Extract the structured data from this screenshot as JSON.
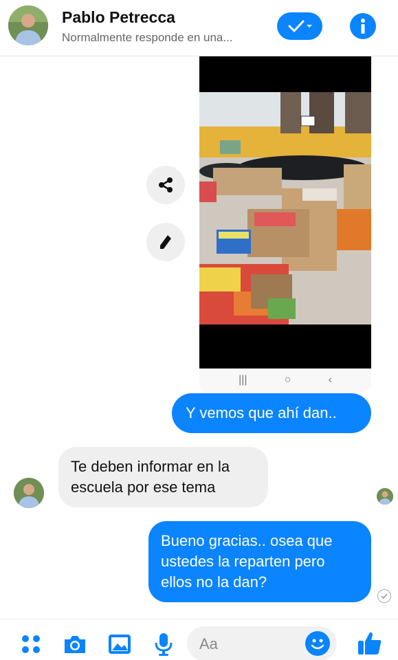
{
  "header": {
    "name": "Pablo Petrecca",
    "status": "Normalmente responde en una..."
  },
  "media": {
    "navbar": [
      "|||",
      "○",
      "‹"
    ]
  },
  "messages": {
    "outgoing_1": "Y vemos que ahí dan..",
    "incoming_1_line1": "Te deben informar en la",
    "incoming_1_line2": "escuela por ese tema",
    "outgoing_2_line1": "Bueno gracias.. osea que",
    "outgoing_2_line2": "ustedes la reparten pero",
    "outgoing_2_line3": "ellos no la dan?"
  },
  "composer": {
    "placeholder": "Aa"
  },
  "colors": {
    "accent": "#0a84ff",
    "incoming_bubble": "#efefef"
  },
  "icons": [
    "check-icon",
    "info-icon",
    "share-icon",
    "pencil-icon",
    "menu-dots-icon",
    "camera-icon",
    "image-icon",
    "microphone-icon",
    "emoji-icon",
    "thumbs-up-icon"
  ]
}
